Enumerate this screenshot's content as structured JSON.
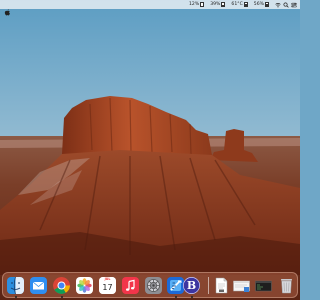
{
  "menubar": {
    "stats": [
      {
        "label": "12%",
        "fraction": 0.12
      },
      {
        "label": "39%",
        "fraction": 0.39
      },
      {
        "label": "61°C",
        "fraction": 0.61
      },
      {
        "label": "56%",
        "fraction": 0.56
      }
    ],
    "icons": [
      "apple-icon",
      "wifi-icon",
      "search-icon",
      "control-center-icon"
    ]
  },
  "dock": {
    "apps": [
      "finder",
      "mail",
      "chrome",
      "photos",
      "calendar",
      "music",
      "system-preferences",
      "xcode",
      "bbedit"
    ],
    "calendar": {
      "month": "JUL",
      "day": "17"
    },
    "bbedit_letter": "B",
    "right_items": [
      "document",
      "preview-window",
      "terminal-window",
      "trash"
    ]
  },
  "colors": {
    "sky_top": "#5f9fc4",
    "sky_bottom": "#d9c9c4",
    "rock": "#9a4526",
    "dock_tint": "#aa5f46"
  }
}
